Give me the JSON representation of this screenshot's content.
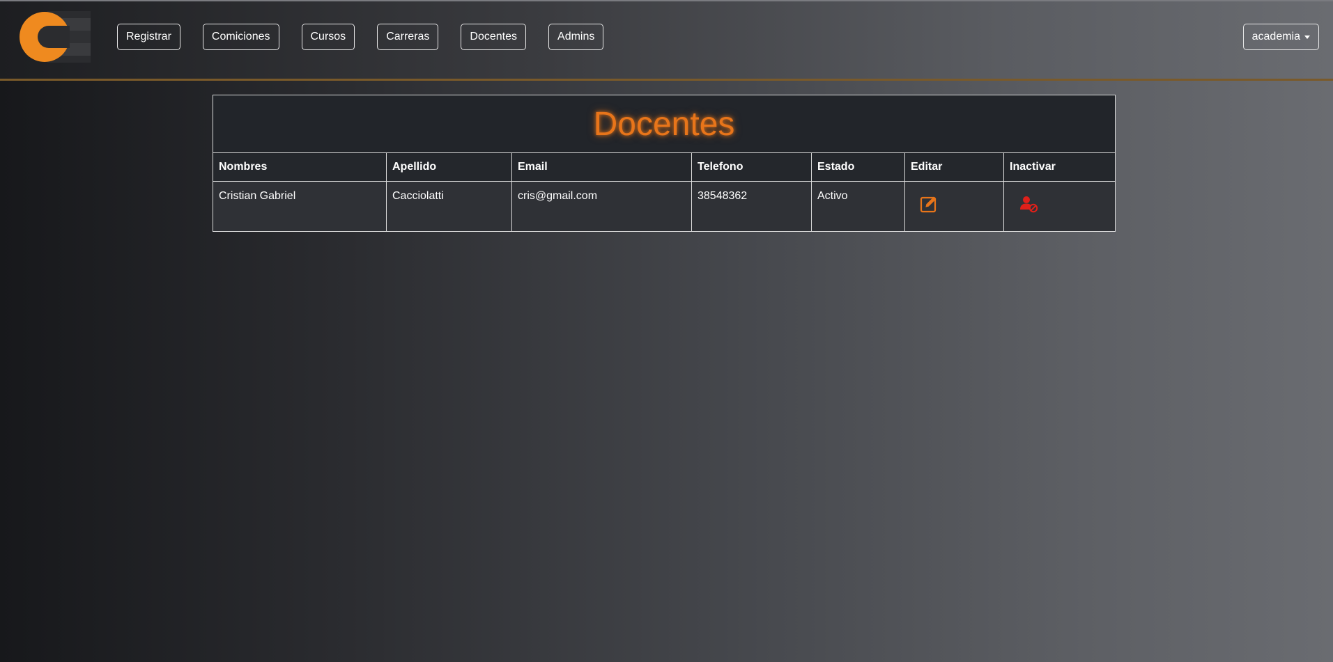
{
  "navbar": {
    "links": [
      {
        "label": "Registrar"
      },
      {
        "label": "Comiciones"
      },
      {
        "label": "Cursos"
      },
      {
        "label": "Carreras"
      },
      {
        "label": "Docentes"
      },
      {
        "label": "Admins"
      }
    ],
    "user_menu_label": "academia"
  },
  "table": {
    "title": "Docentes",
    "columns": [
      "Nombres",
      "Apellido",
      "Email",
      "Telefono",
      "Estado",
      "Editar",
      "Inactivar"
    ],
    "rows": [
      {
        "nombres": "Cristian Gabriel",
        "apellido": "Cacciolatti",
        "email": "cris@gmail.com",
        "telefono": "38548362",
        "estado": "Activo",
        "editar_icon": "edit-icon",
        "inactivar_icon": "user-block-icon"
      }
    ]
  },
  "colors": {
    "accent": "#e8751a",
    "danger": "#e0201a"
  }
}
